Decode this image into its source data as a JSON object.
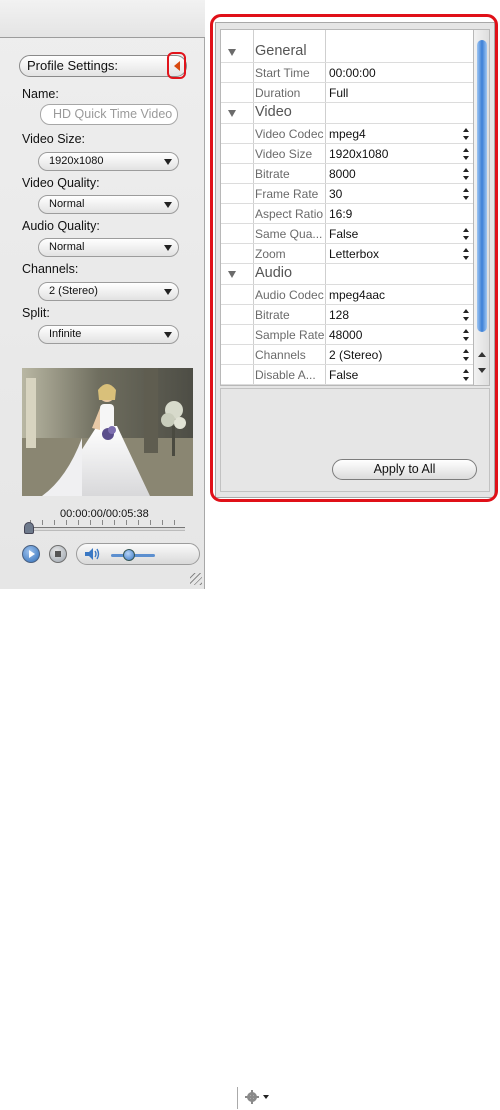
{
  "left": {
    "profile_settings": "Profile Settings:",
    "name_label": "Name:",
    "name_value": "HD Quick Time Video",
    "video_size_label": "Video Size:",
    "video_size_value": "1920x1080",
    "video_quality_label": "Video Quality:",
    "video_quality_value": "Normal",
    "audio_quality_label": "Audio Quality:",
    "audio_quality_value": "Normal",
    "channels_label": "Channels:",
    "channels_value": "2 (Stereo)",
    "split_label": "Split:",
    "split_value": "Infinite",
    "time_display": "00:00:00/00:05:38",
    "playback_progress": 0.0
  },
  "grid": {
    "general": {
      "title": "General",
      "rows": [
        {
          "name": "Start Time",
          "value": "00:00:00"
        },
        {
          "name": "Duration",
          "value": "Full"
        }
      ]
    },
    "video": {
      "title": "Video",
      "rows": [
        {
          "name": "Video Codec",
          "value": "mpeg4"
        },
        {
          "name": "Video Size",
          "value": "1920x1080"
        },
        {
          "name": "Bitrate",
          "value": "8000"
        },
        {
          "name": "Frame Rate",
          "value": "30"
        },
        {
          "name": "Aspect Ratio",
          "value": "16:9"
        },
        {
          "name": "Same Qua...",
          "value": "False"
        },
        {
          "name": "Zoom",
          "value": "Letterbox"
        }
      ]
    },
    "audio": {
      "title": "Audio",
      "rows": [
        {
          "name": "Audio Codec",
          "value": "mpeg4aac"
        },
        {
          "name": "Bitrate",
          "value": "128"
        },
        {
          "name": "Sample Rate",
          "value": "48000"
        },
        {
          "name": "Channels",
          "value": "2 (Stereo)"
        },
        {
          "name": "Disable A...",
          "value": "False"
        }
      ]
    },
    "apply_all": "Apply to All"
  },
  "colors": {
    "highlight_red": "#e01018",
    "scroll_blue": "#3b7fd6",
    "arrow_orange": "#d84a10"
  }
}
